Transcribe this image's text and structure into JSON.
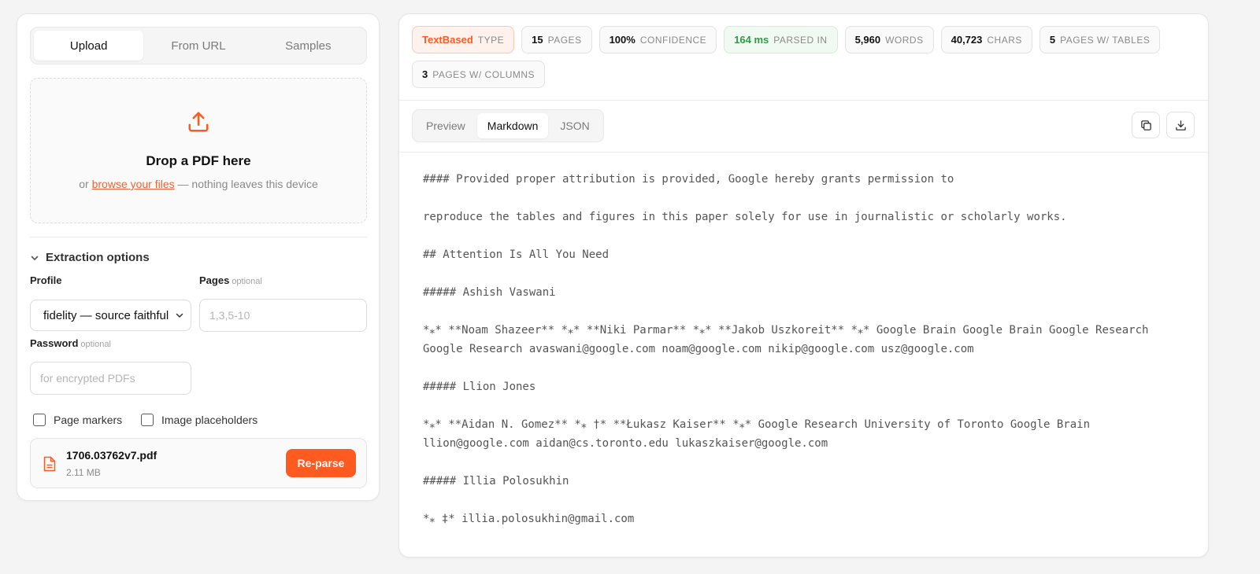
{
  "source_tabs": [
    "Upload",
    "From URL",
    "Samples"
  ],
  "dropzone": {
    "icon": "upload-icon",
    "title": "Drop a PDF here",
    "sub_prefix": "or ",
    "browse_link": "browse your files",
    "sub_suffix": " — nothing leaves this device"
  },
  "options": {
    "header": "Extraction options",
    "profile_label": "Profile",
    "profile_value": "fidelity — source faithful",
    "pages_label": "Pages",
    "pages_optional": "optional",
    "pages_placeholder": "1,3,5-10",
    "password_label": "Password",
    "password_optional": "optional",
    "password_placeholder": "for encrypted PDFs",
    "checkbox_page_markers": "Page markers",
    "checkbox_image_placeholders": "Image placeholders"
  },
  "file": {
    "name": "1706.03762v7.pdf",
    "size": "2.11 MB",
    "button": "Re-parse"
  },
  "stats": [
    {
      "value": "TextBased",
      "label": "TYPE",
      "variant": "orange"
    },
    {
      "value": "15",
      "label": "PAGES",
      "variant": "default"
    },
    {
      "value": "100%",
      "label": "CONFIDENCE",
      "variant": "default"
    },
    {
      "value": "164 ms",
      "label": "PARSED IN",
      "variant": "green"
    },
    {
      "value": "5,960",
      "label": "WORDS",
      "variant": "default"
    },
    {
      "value": "40,723",
      "label": "CHARS",
      "variant": "default"
    },
    {
      "value": "5",
      "label": "PAGES W/ TABLES",
      "variant": "default"
    },
    {
      "value": "3",
      "label": "PAGES W/ COLUMNS",
      "variant": "default"
    }
  ],
  "view_tabs": [
    "Preview",
    "Markdown",
    "JSON"
  ],
  "actions": {
    "copy_icon": "copy-icon",
    "download_icon": "download-icon"
  },
  "markdown_lines": [
    "#### Provided proper attribution is provided, Google hereby grants permission to",
    "reproduce the tables and figures in this paper solely for use in journalistic or scholarly works.",
    "## Attention Is All You Need",
    "##### Ashish Vaswani",
    "*⁎* **Noam Shazeer** *⁎* **Niki Parmar** *⁎* **Jakob Uszkoreit** *⁎* Google Brain Google Brain Google Research Google Research avaswani@google.com noam@google.com nikip@google.com usz@google.com",
    "##### Llion Jones",
    "*⁎* **Aidan N. Gomez** *⁎ †* **Łukasz Kaiser** *⁎* Google Research University of Toronto Google Brain llion@google.com aidan@cs.toronto.edu lukaszkaiser@google.com",
    "##### Illia Polosukhin",
    "*⁎ ‡* illia.polosukhin@gmail.com"
  ]
}
